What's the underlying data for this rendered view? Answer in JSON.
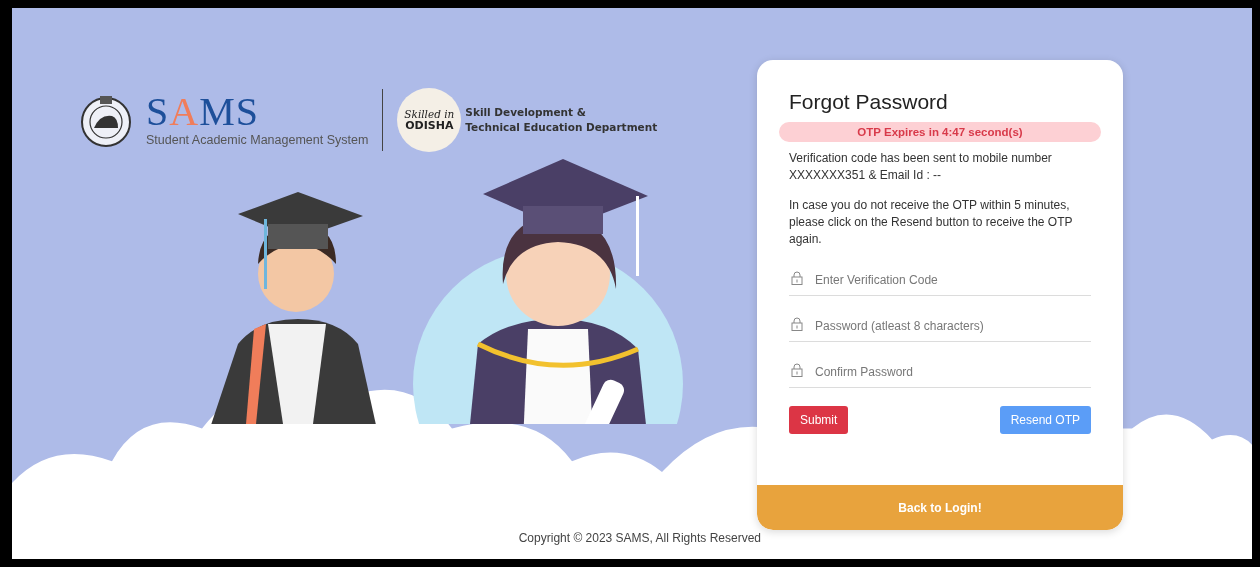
{
  "branding": {
    "title": "SAMS",
    "subtitle": "Student Academic Management System",
    "badge_lines": [
      "Skilled in",
      "ODISHA"
    ],
    "department_lines": [
      "Skill Development &",
      "Technical Education Department"
    ]
  },
  "card": {
    "title": "Forgot Password",
    "timer": "OTP Expires in 4:47 second(s)",
    "messages": [
      "Verification code has been sent to mobile number XXXXXXX351 & Email Id : --",
      "In case you do not receive the OTP within 5 minutes, please click on the Resend button to receive the OTP again."
    ],
    "fields": [
      {
        "placeholder": "Enter Verification Code"
      },
      {
        "placeholder": "Password (atleast 8 characters)"
      },
      {
        "placeholder": "Confirm Password"
      }
    ],
    "buttons": [
      {
        "label": "Submit",
        "kind": "danger"
      },
      {
        "label": "Resend OTP",
        "kind": "info"
      }
    ],
    "back_link": "Back to Login!"
  },
  "footer": {
    "copyright": "Copyright © 2023 SAMS, All Rights Reserved"
  }
}
